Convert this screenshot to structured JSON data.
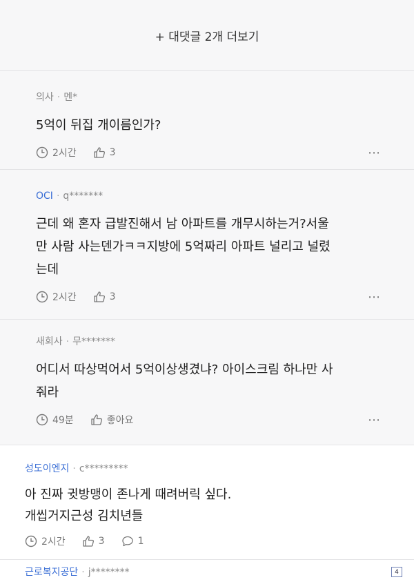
{
  "more_replies": {
    "label": "+ 대댓글 2개 더보기"
  },
  "replies": [
    {
      "nick": "의사",
      "user": "멘*",
      "body": "5억이 뒤집 개이름인가?",
      "time": "2시간",
      "likes": "3",
      "nick_blue": false
    },
    {
      "nick": "OCI",
      "user": "q*******",
      "body": "근데 왜 혼자 급발진해서 남 아파트를 개무시하는거?서울\n만 사람 사는덴가ㅋㅋ지방에 5억짜리 아파트 널리고 널렸\n는데",
      "time": "2시간",
      "likes": "3",
      "nick_blue": true
    },
    {
      "nick": "새회사",
      "user": "무*******",
      "body": "어디서 따상먹어서 5억이상생겼냐? 아이스크림 하나만 사\n줘라",
      "time": "49분",
      "likes": "좋아요",
      "nick_blue": false
    }
  ],
  "comment": {
    "nick": "성도이엔지",
    "user": "c*********",
    "body": "아 진짜 귓방맹이 존나게 때려버릭 싶다.\n개씹거지근성 김치년들",
    "time": "2시간",
    "likes": "3",
    "replies": "1"
  },
  "next_comment": {
    "nick": "근로복지공단",
    "user": "j********"
  },
  "more_icon": "⋯",
  "page_badge": "4",
  "colors": {
    "nick_blue": "#3b6fd6",
    "reply_bg": "#f7f7f8"
  },
  "icons": [
    "clock-icon",
    "thumbs-up-icon",
    "speech-bubble-icon",
    "more-dots-icon"
  ]
}
